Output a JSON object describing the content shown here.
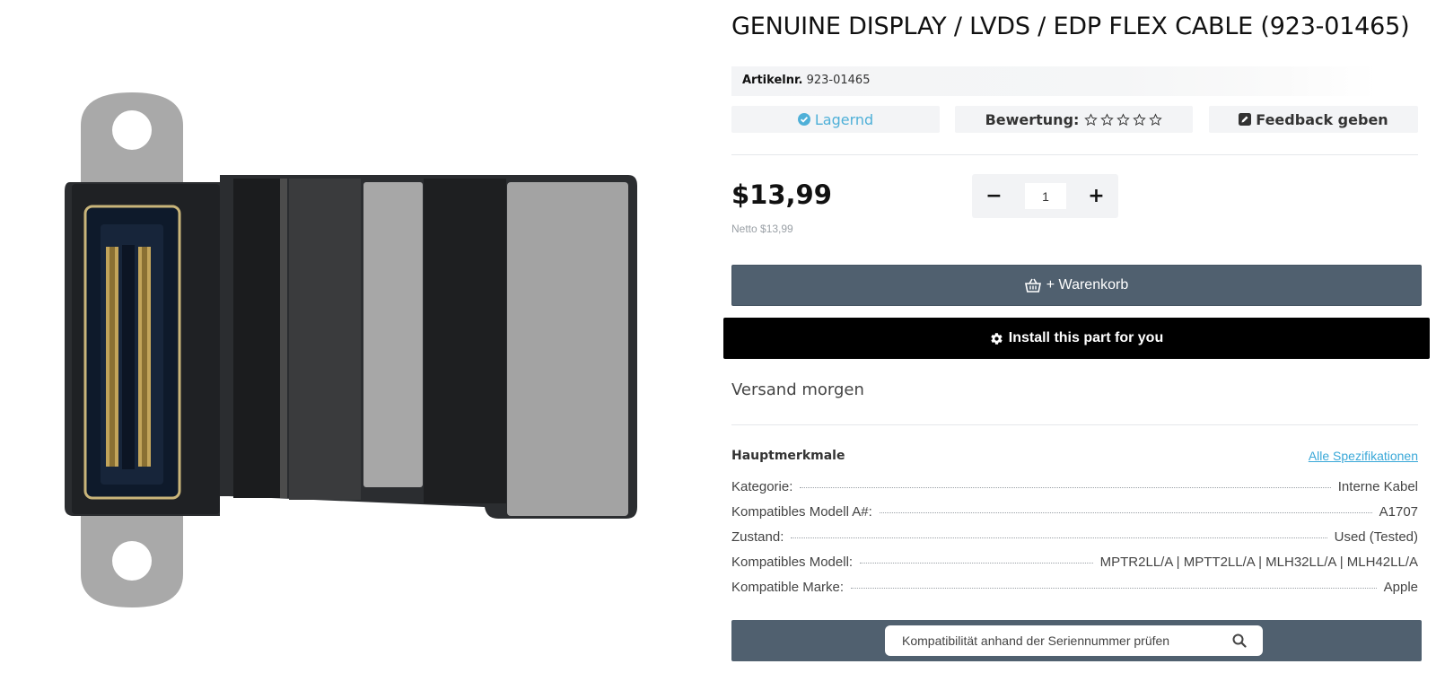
{
  "product": {
    "title": "GENUINE DISPLAY / LVDS / EDP FLEX CABLE (923-01465)",
    "sku_label": "Artikelnr.",
    "sku_value": "923-01465",
    "image_icon": "flex-cable-product-photo"
  },
  "status": {
    "stock_label": "Lagernd",
    "stock_icon": "check-circle-icon",
    "rating_label": "Bewertung:",
    "rating_stars": 0,
    "rating_max": 5,
    "feedback_label": "Feedback geben",
    "feedback_icon": "edit-icon"
  },
  "pricing": {
    "price": "$13,99",
    "net_label": "Netto $13,99"
  },
  "quantity": {
    "minus": "−",
    "value": "1",
    "plus": "+"
  },
  "actions": {
    "cart_label": "+ Warenkorb",
    "cart_icon": "basket-icon",
    "install_label": "Install this part for you",
    "install_icon": "gear-icon"
  },
  "shipping": {
    "text": "Versand morgen"
  },
  "features": {
    "title": "Hauptmerkmale",
    "all_specs_link": "Alle Spezifikationen",
    "specs": [
      {
        "key": "Kategorie:",
        "value": "Interne Kabel"
      },
      {
        "key": "Kompatibles Modell A#:",
        "value": "A1707"
      },
      {
        "key": "Zustand:",
        "value": "Used (Tested)"
      },
      {
        "key": "Kompatibles Modell:",
        "value": "MPTR2LL/A | MPTT2LL/A | MLH32LL/A | MLH42LL/A"
      },
      {
        "key": "Kompatible Marke:",
        "value": "Apple"
      }
    ]
  },
  "serial_check": {
    "placeholder": "Kompatibilität anhand der Seriennummer prüfen",
    "search_icon": "search-icon"
  },
  "colors": {
    "accent_blue": "#4fb0d8",
    "slate": "#50606f",
    "black": "#000000",
    "badge_bg": "#f3f4f6"
  }
}
